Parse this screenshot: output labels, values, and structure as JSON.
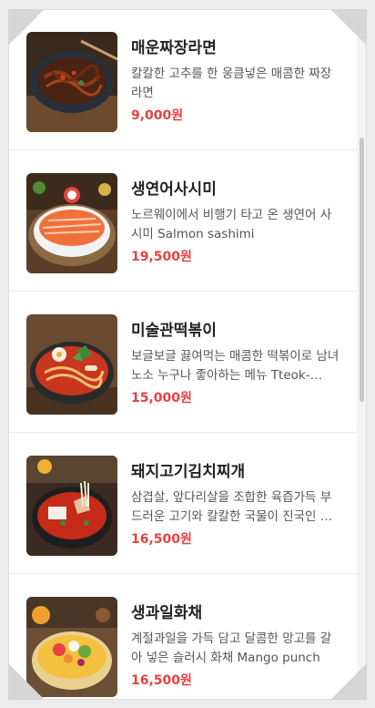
{
  "menu": {
    "items": [
      {
        "name": "매운짜장라면",
        "description": "칼칼한 고추를 한 웅큼넣은 매콤한 짜장라면",
        "price": "9,000원",
        "image": "spicy-jjajang-ramen-photo"
      },
      {
        "name": "생연어사시미",
        "description": "노르웨이에서 비행기 타고 온 생연어 사시미 Salmon sashimi",
        "price": "19,500원",
        "image": "salmon-sashimi-photo"
      },
      {
        "name": "미술관떡볶이",
        "description": "보글보글 끓여먹는 매콤한 떡볶이로 남녀노소 누구나 좋아하는 메뉴 Tteok-bokki",
        "price": "15,000원",
        "image": "tteokbokki-photo"
      },
      {
        "name": "돼지고기김치찌개",
        "description": "삼겹살, 앞다리살을 조합한 육즙가득 부드러운 고기와 칼칼한 국물이 진국인 김치찌개",
        "price": "16,500원",
        "image": "kimchi-stew-photo"
      },
      {
        "name": "생과일화채",
        "description": "계절과일을 가득 담고 달콤한 망고를 갈아 넣은 슬러시 화채 Mango punch",
        "price": "16,500원",
        "image": "fruit-punch-photo"
      }
    ]
  },
  "colors": {
    "price": "#e8413f",
    "title": "#222222",
    "description": "#555555"
  }
}
